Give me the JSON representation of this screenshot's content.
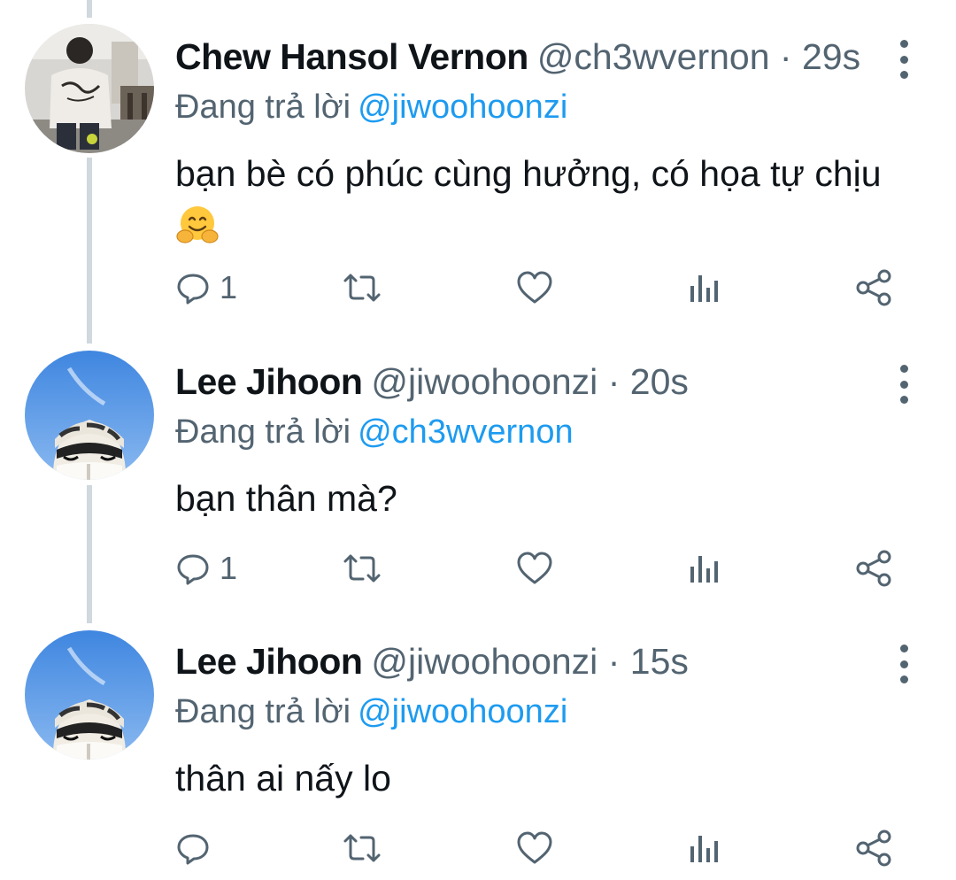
{
  "colors": {
    "text": "#0f1419",
    "secondary": "#536471",
    "link": "#1d9bf0",
    "thread_line": "#cfd9de"
  },
  "tweets": [
    {
      "name": "Chew Hansol Vernon",
      "handle": "@ch3wvernon",
      "separator": "·",
      "time": "29s",
      "reply_label": "Đang trả lời",
      "reply_to": "@jiwoohoonzi",
      "text": "bạn bè có phúc cùng hưởng, có họa tự chịu",
      "emoji": "hugging-face-emoji",
      "reply_count": "1"
    },
    {
      "name": "Lee Jihoon",
      "handle": "@jiwoohoonzi",
      "separator": "·",
      "time": "20s",
      "reply_label": "Đang trả lời",
      "reply_to": "@ch3wvernon",
      "text": "bạn thân mà?",
      "reply_count": "1"
    },
    {
      "name": "Lee Jihoon",
      "handle": "@jiwoohoonzi",
      "separator": "·",
      "time": "15s",
      "reply_label": "Đang trả lời",
      "reply_to": "@jiwoohoonzi",
      "text": "thân ai nấy lo",
      "reply_count": ""
    }
  ],
  "icons": {
    "reply": "reply-icon",
    "retweet": "retweet-icon",
    "like": "heart-icon",
    "views": "views-icon",
    "share": "share-icon",
    "more": "more-options-icon"
  }
}
